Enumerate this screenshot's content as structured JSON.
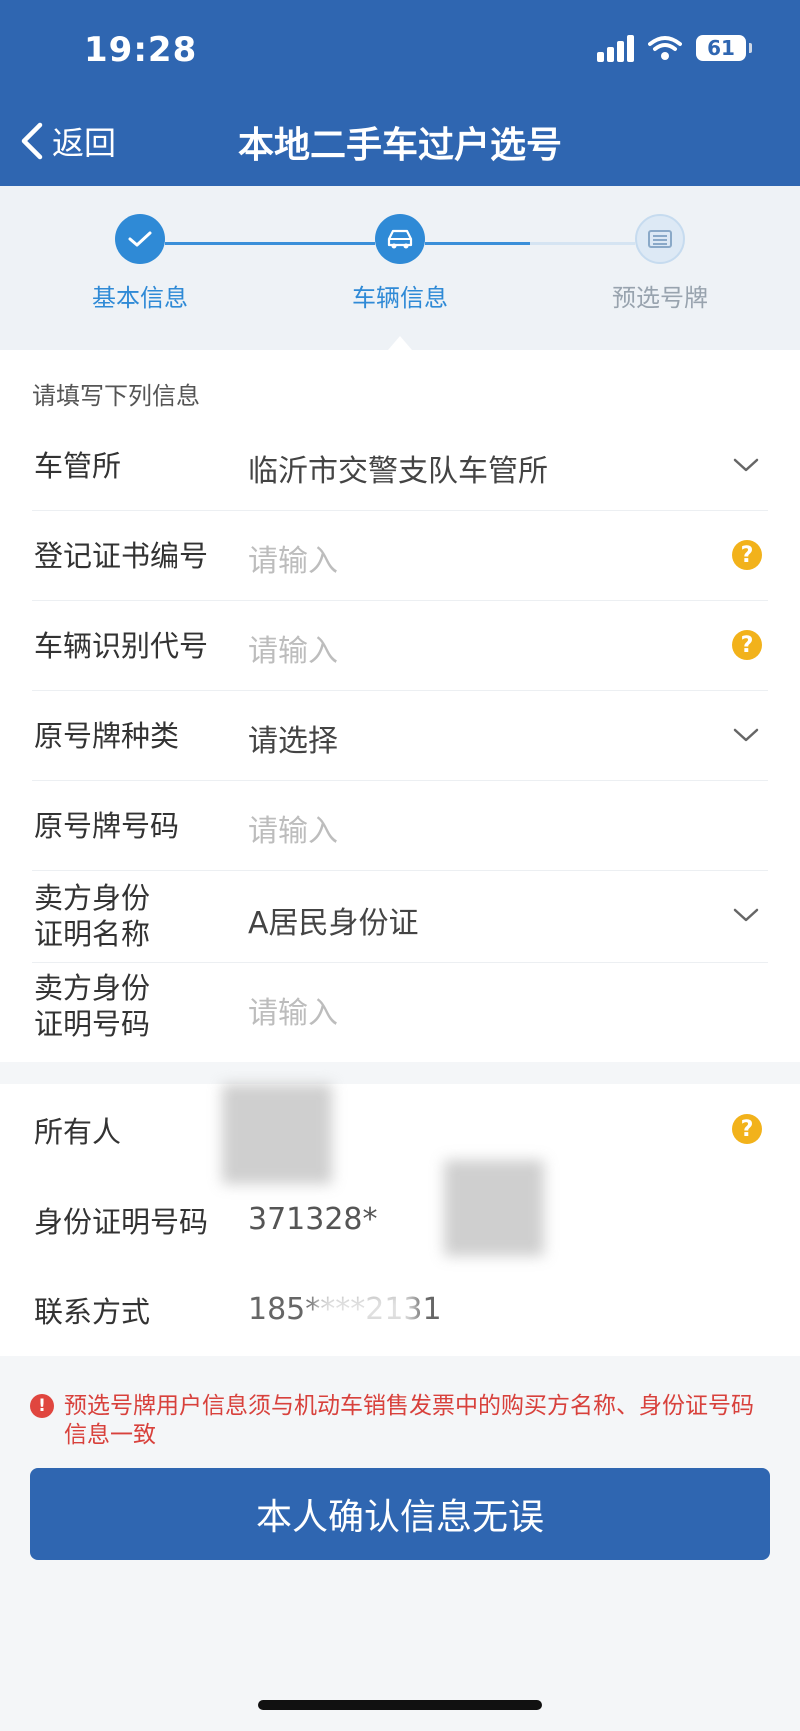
{
  "status_bar": {
    "time": "19:28",
    "battery": "61"
  },
  "nav": {
    "back_label": "返回",
    "title": "本地二手车过户选号"
  },
  "steps": [
    {
      "label": "基本信息",
      "state": "done"
    },
    {
      "label": "车辆信息",
      "state": "current"
    },
    {
      "label": "预选号牌",
      "state": "pending"
    }
  ],
  "form": {
    "hint": "请填写下列信息",
    "fields": [
      {
        "label": "车管所",
        "value": "临沂市交警支队车管所",
        "control": "select"
      },
      {
        "label": "登记证书编号",
        "placeholder": "请输入",
        "control": "input-help"
      },
      {
        "label": "车辆识别代号",
        "placeholder": "请输入",
        "control": "input-help"
      },
      {
        "label": "原号牌种类",
        "value": "请选择",
        "control": "select"
      },
      {
        "label": "原号牌号码",
        "placeholder": "请输入",
        "control": "input"
      },
      {
        "label_line1": "卖方身份",
        "label_line2": "证明名称",
        "value": "A居民身份证",
        "control": "select"
      },
      {
        "label_line1": "卖方身份",
        "label_line2": "证明号码",
        "placeholder": "请输入",
        "control": "input"
      }
    ]
  },
  "owner": {
    "name_label": "所有人",
    "id_label": "身份证明号码",
    "id_value": "371328*",
    "contact_label": "联系方式",
    "contact_value": "185****2131"
  },
  "notice": "预选号牌用户信息须与机动车销售发票中的购买方名称、身份证号码信息一致",
  "confirm_button": "本人确认信息无误",
  "colors": {
    "primary": "#2f66b1",
    "step_active": "#2f8ad6",
    "warning": "#d8413c",
    "help": "#f2b21b"
  }
}
